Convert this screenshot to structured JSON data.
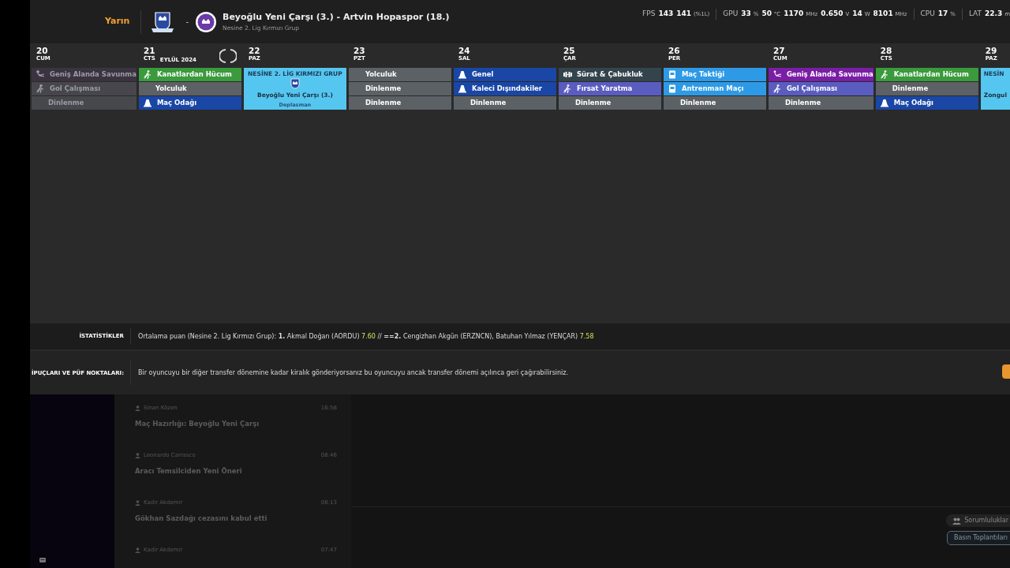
{
  "header": {
    "when": "Yarın",
    "separator": "-",
    "match_title": "Beyoğlu Yeni Çarşı (3.) - Artvin Hopaspor (18.)",
    "competition": "Nesine 2. Lig Kırmızı Grup",
    "perf": [
      {
        "label": "FPS",
        "readings": [
          {
            "value": "143"
          },
          {
            "value": "141",
            "unit": "(%1L)"
          }
        ]
      },
      {
        "label": "GPU",
        "readings": [
          {
            "value": "33",
            "unit": "%"
          },
          {
            "value": "50",
            "unit": "°C"
          },
          {
            "value": "1170",
            "unit": "MHz"
          },
          {
            "value": "0.650",
            "unit": "V"
          },
          {
            "value": "14",
            "unit": "W"
          },
          {
            "value": "8101",
            "unit": "MHz"
          }
        ]
      },
      {
        "label": "CPU",
        "readings": [
          {
            "value": "17",
            "unit": "%"
          }
        ]
      },
      {
        "label": "LAT",
        "readings": [
          {
            "value": "22.3",
            "unit": "m"
          }
        ]
      }
    ]
  },
  "calendar": {
    "month": "EYLÜL 2024",
    "days": [
      {
        "day": "20",
        "weekday": "CUM",
        "past": true,
        "sessions": [
          {
            "kind": "slide",
            "label": "Geniş Alanda Savunma",
            "color": "#3b3340"
          },
          {
            "kind": "run",
            "label": "Gol Çalışması",
            "color": "#46464c"
          },
          {
            "kind": "plain",
            "label": "Dinlenme",
            "color": "#46484c"
          }
        ]
      },
      {
        "day": "21",
        "weekday": "CTS",
        "past": false,
        "show_month": true,
        "sessions": [
          {
            "kind": "run",
            "label": "Kanatlardan Hücum",
            "color": "#3a9a3c"
          },
          {
            "kind": "plain",
            "label": "Yolculuk",
            "color": "#5c6166"
          },
          {
            "kind": "cone",
            "label": "Maç Odağı",
            "color": "#1a47a6"
          }
        ]
      },
      {
        "day": "22",
        "weekday": "PAZ",
        "past": false,
        "match": {
          "competition": "NESİNE 2. LİG KIRMIZI GRUP",
          "opponent": "Beyoğlu Yeni Çarşı (3.)",
          "venue": "Deplasman"
        }
      },
      {
        "day": "23",
        "weekday": "PZT",
        "past": false,
        "sessions": [
          {
            "kind": "plain",
            "label": "Yolculuk",
            "color": "#5c6166"
          },
          {
            "kind": "plain",
            "label": "Dinlenme",
            "color": "#5c6166"
          },
          {
            "kind": "plain",
            "label": "Dinlenme",
            "color": "#5c6166"
          }
        ]
      },
      {
        "day": "24",
        "weekday": "SAL",
        "past": false,
        "sessions": [
          {
            "kind": "cone",
            "label": "Genel",
            "color": "#1a47a6"
          },
          {
            "kind": "cone",
            "label": "Kaleci Dışındakiler",
            "color": "#1a47a6"
          },
          {
            "kind": "plain",
            "label": "Dinlenme",
            "color": "#5c6166"
          }
        ]
      },
      {
        "day": "25",
        "weekday": "ÇAR",
        "past": false,
        "sessions": [
          {
            "kind": "dumbbell",
            "label": "Sürat & Çabukluk",
            "color": "#34444c"
          },
          {
            "kind": "run",
            "label": "Fırsat Yaratma",
            "color": "#5a5cc0"
          },
          {
            "kind": "plain",
            "label": "Dinlenme",
            "color": "#5c6166"
          }
        ]
      },
      {
        "day": "26",
        "weekday": "PER",
        "past": false,
        "sessions": [
          {
            "kind": "board",
            "label": "Maç Taktiği",
            "color": "#2e9ae6"
          },
          {
            "kind": "board",
            "label": "Antrenman Maçı",
            "color": "#2e9ae6"
          },
          {
            "kind": "plain",
            "label": "Dinlenme",
            "color": "#5c6166"
          }
        ]
      },
      {
        "day": "27",
        "weekday": "CUM",
        "past": false,
        "sessions": [
          {
            "kind": "slide",
            "label": "Geniş Alanda Savunma",
            "color": "#7a1ea6"
          },
          {
            "kind": "run",
            "label": "Gol Çalışması",
            "color": "#5a5cc0"
          },
          {
            "kind": "plain",
            "label": "Dinlenme",
            "color": "#5c6166"
          }
        ]
      },
      {
        "day": "28",
        "weekday": "CTS",
        "past": false,
        "sessions": [
          {
            "kind": "run",
            "label": "Kanatlardan Hücum",
            "color": "#3a9a3c"
          },
          {
            "kind": "plain",
            "label": "Dinlenme",
            "color": "#5c6166"
          },
          {
            "kind": "cone",
            "label": "Maç Odağı",
            "color": "#1a47a6"
          }
        ]
      },
      {
        "day": "29",
        "weekday": "PAZ",
        "past": false,
        "match": {
          "competition": "NESİN",
          "opponent": "Zongul"
        }
      }
    ]
  },
  "stats": {
    "label": "İSTATİSTİKLER",
    "parts": [
      {
        "kind": "text",
        "text": "Ortalama puan (Nesine 2. Lig Kırmızı Grup): **1.** Akmal Doğan (AORDU)"
      },
      {
        "kind": "score",
        "text": "7.60"
      },
      {
        "kind": "text",
        "text": "// **==2.** Cengizhan Akgün (ERZNCN), Batuhan Yılmaz (YENÇAR)"
      },
      {
        "kind": "score",
        "text": "7.58"
      }
    ]
  },
  "tips": {
    "label": "İPUÇLARI VE PÜF NOKTALARI:",
    "text": "Bir oyuncuyu bir diğer transfer dönemine kadar kiralık gönderiyorsanız bu oyuncuyu ancak transfer dönemi açılınca geri çağırabilirsiniz."
  },
  "news": [
    {
      "sender": "Sinan Közen",
      "time": "16:58",
      "title": "Maç Hazırlığı: Beyoğlu Yeni Çarşı"
    },
    {
      "sender": "Leonardo Carrasco",
      "time": "08:46",
      "title": "Aracı Temsilciden Yeni Öneri"
    },
    {
      "sender": "Kadir Akdemir",
      "time": "08:13",
      "title": "Gökhan Sazdağı cezasını kabul etti"
    },
    {
      "sender": "Kadir Akdemir",
      "time": "07:47"
    }
  ],
  "actions": [
    {
      "kind": "menu",
      "label": "Sorumluluklar"
    },
    {
      "kind": "outline",
      "label": "Basın Toplantıları"
    }
  ]
}
